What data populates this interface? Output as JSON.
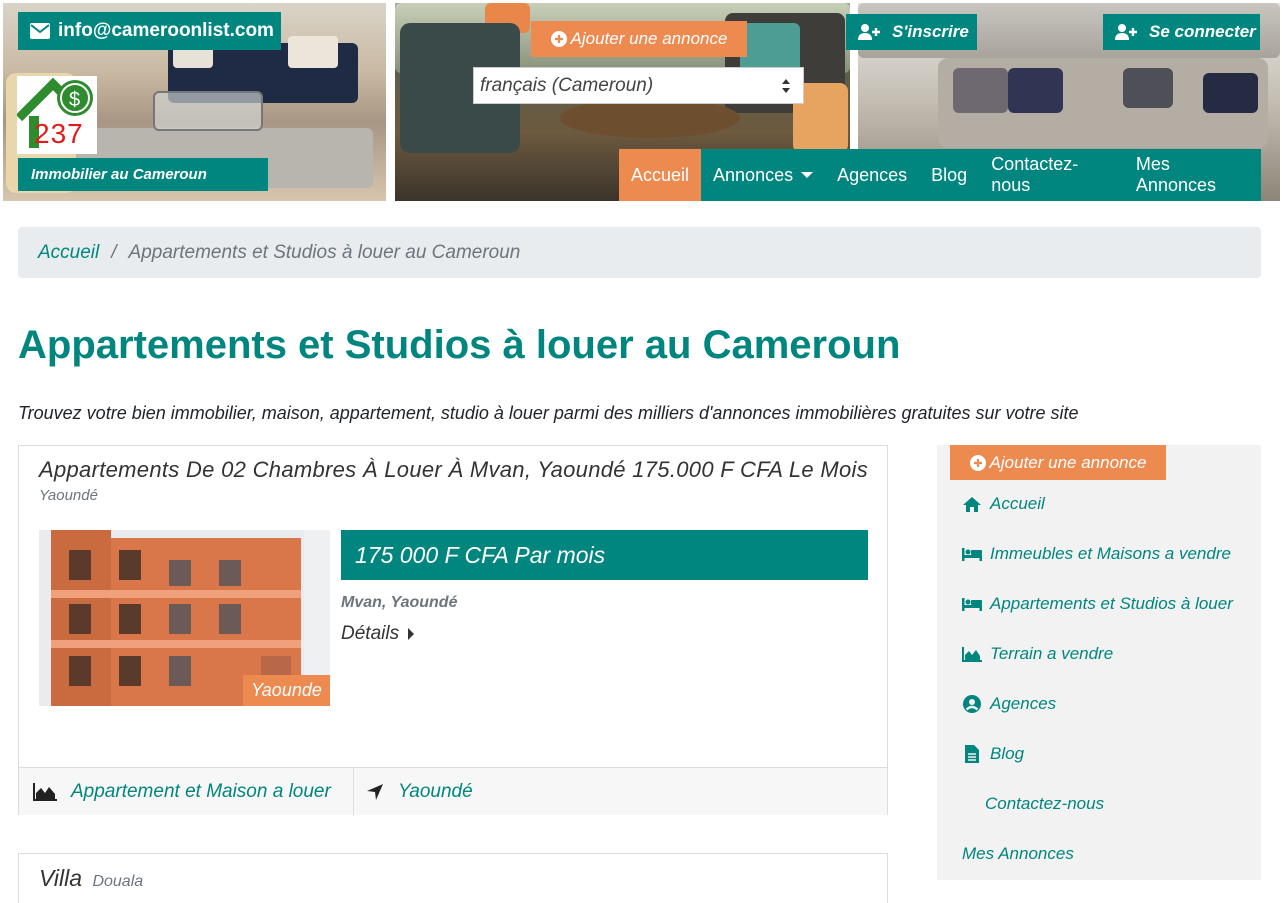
{
  "header": {
    "email": "info@cameroonlist.com",
    "logo_number": "237",
    "tagline": "Immobilier au Cameroun",
    "add_listing": "Ajouter une annonce",
    "language": "français (Cameroun)",
    "signup": "S'inscrire",
    "login": "Se connecter"
  },
  "nav": {
    "items": [
      {
        "label": "Accueil"
      },
      {
        "label": "Annonces"
      },
      {
        "label": "Agences"
      },
      {
        "label": "Blog"
      },
      {
        "label": "Contactez-nous"
      },
      {
        "label": "Mes Annonces"
      }
    ]
  },
  "breadcrumb": {
    "home": "Accueil",
    "separator": "/",
    "current": "Appartements et Studios à louer au Cameroun"
  },
  "page": {
    "title": "Appartements et Studios à louer au Cameroun",
    "subtitle": "Trouvez votre bien immobilier, maison, appartement, studio à louer parmi des milliers d'annonces immobilières gratuites sur votre site"
  },
  "listings": [
    {
      "title": "Appartements De 02 Chambres À Louer À Mvan, Yaoundé 175.000 F CFA Le Mois",
      "city": "Yaoundé",
      "image_badge": "Yaounde",
      "price": "175 000 F CFA Par mois",
      "location": "Mvan, Yaoundé",
      "details": "Détails",
      "category": "Appartement et Maison a louer",
      "place": "Yaoundé"
    },
    {
      "title": "Villa",
      "city": "Douala"
    }
  ],
  "sidebar": {
    "add_listing": "Ajouter une annonce",
    "items": [
      {
        "label": "Accueil",
        "icon": "home-icon"
      },
      {
        "label": "Immeubles et Maisons a vendre",
        "icon": "bed-icon"
      },
      {
        "label": "Appartements et Studios à louer",
        "icon": "bed-icon"
      },
      {
        "label": "Terrain a vendre",
        "icon": "area-chart-icon"
      },
      {
        "label": "Agences",
        "icon": "user-circle-icon"
      },
      {
        "label": "Blog",
        "icon": "file-icon"
      },
      {
        "label": "Contactez-nous",
        "icon": ""
      },
      {
        "label": "Mes Annonces",
        "icon": ""
      }
    ]
  },
  "colors": {
    "teal": "#00867f",
    "orange": "#ed8a50",
    "breadcrumb_bg": "#e9ecef"
  }
}
